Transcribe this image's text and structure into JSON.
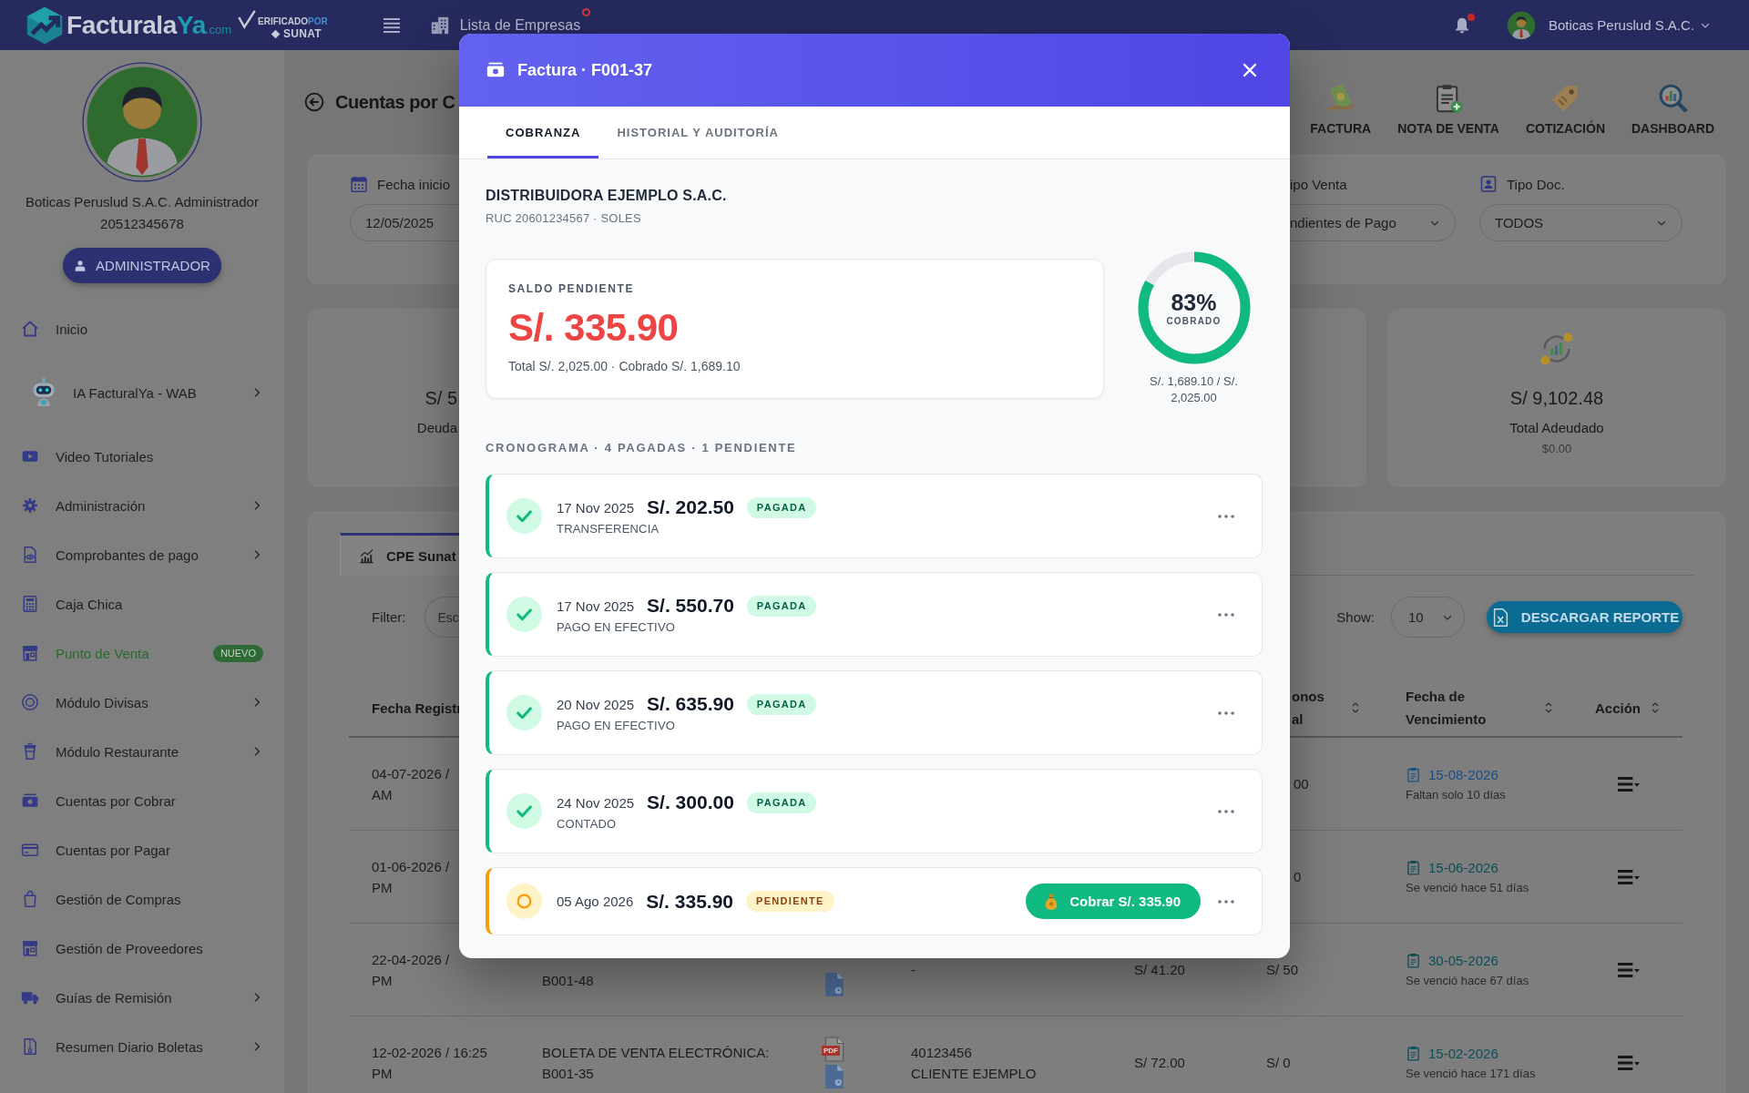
{
  "top_bar": {
    "brand": {
      "name": "Facturala",
      "accent": "Ya",
      "suffix": ".com"
    },
    "verified_badge": {
      "text": "ERIFICADO",
      "suffix": "POR",
      "authority": "SUNAT"
    },
    "company_list": {
      "label": "Lista de Empresas",
      "indicator": true
    },
    "notifications": {
      "unread": true
    },
    "account": "Boticas Peruslud S.A.C."
  },
  "sidebar": {
    "profile": {
      "name": "Boticas Peruslud S.A.C. Administrador",
      "ruc": "20512345678",
      "role": "ADMINISTRADOR"
    },
    "items": [
      {
        "kind": "link",
        "label": "Inicio",
        "expandable": false,
        "highlighted": false
      },
      {
        "kind": "assistant",
        "label": "IA FacturalYa - WAB",
        "expandable": true,
        "highlighted": false
      },
      {
        "kind": "link",
        "label": "Video Tutoriales",
        "expandable": false,
        "highlighted": false
      },
      {
        "kind": "link",
        "label": "Administración",
        "expandable": true,
        "highlighted": false
      },
      {
        "kind": "link",
        "label": "Comprobantes de pago",
        "expandable": true,
        "highlighted": false
      },
      {
        "kind": "link",
        "label": "Caja Chica",
        "expandable": false,
        "highlighted": false
      },
      {
        "kind": "link",
        "label": "Punto de Venta",
        "expandable": false,
        "highlighted": true,
        "badge": "NUEVO"
      },
      {
        "kind": "link",
        "label": "Módulo Divisas",
        "expandable": true,
        "highlighted": false
      },
      {
        "kind": "link",
        "label": "Módulo Restaurante",
        "expandable": true,
        "highlighted": false
      },
      {
        "kind": "link",
        "label": "Cuentas por Cobrar",
        "expandable": false,
        "highlighted": false
      },
      {
        "kind": "link",
        "label": "Cuentas por Pagar",
        "expandable": false,
        "highlighted": false
      },
      {
        "kind": "link",
        "label": "Gestión de Compras",
        "expandable": false,
        "highlighted": false
      },
      {
        "kind": "link",
        "label": "Gestión de Proveedores",
        "expandable": false,
        "highlighted": false
      },
      {
        "kind": "link",
        "label": "Guías de Remisión",
        "expandable": true,
        "highlighted": false
      },
      {
        "kind": "link",
        "label": "Resumen Diario Boletas",
        "expandable": true,
        "highlighted": false
      }
    ]
  },
  "page": {
    "title": "Cuentas por C",
    "quick_actions": [
      {
        "label": "FACTURA"
      },
      {
        "label": "NOTA DE VENTA"
      },
      {
        "label": "COTIZACIÓN"
      },
      {
        "label": "DASHBOARD"
      }
    ]
  },
  "filters": {
    "start_date": {
      "label": "Fecha inicio",
      "value": "12/05/2025"
    },
    "sale_type": {
      "label": "ipo Venta",
      "value": "ndientes de Pago"
    },
    "doc_type": {
      "label": "Tipo Doc.",
      "value": "TODOS"
    }
  },
  "summary_cards": {
    "debt": {
      "amount": "S/ 5",
      "label": "Deuda"
    },
    "total_owed": {
      "amount": "S/ 9,102.48",
      "label": "Total Adeudado",
      "sub": "$0.00"
    }
  },
  "table_panel": {
    "tabs": [
      {
        "label": "CPE Sunat",
        "selected": true
      }
    ],
    "filter": {
      "label": "Filter:",
      "placeholder": "Esc"
    },
    "page_size": {
      "label": "Show:",
      "value": "10"
    },
    "download_button": "DESCARGAR REPORTE",
    "columns": [
      {
        "lines": [
          "Fecha Registr"
        ]
      },
      {
        "lines": [
          "onos",
          "al"
        ],
        "sortable": true
      },
      {
        "lines": [
          "Fecha de",
          "Vencimiento"
        ],
        "sortable": true
      },
      {
        "lines": [
          "Acción"
        ],
        "sortable": true
      }
    ],
    "rows": [
      {
        "registered": [
          "04-07-2026 /",
          "AM"
        ],
        "paid": "00",
        "due": {
          "date": "15-08-2026",
          "note": "Faltan solo 10 días",
          "overdue": false
        }
      },
      {
        "registered": [
          "01-06-2026 /",
          "PM"
        ],
        "paid": "0",
        "due": {
          "date": "15-06-2026",
          "note": "Se venció hace 51 días",
          "overdue": true
        }
      },
      {
        "registered": [
          "22-04-2026 /",
          "PM"
        ],
        "document": {
          "number": "B001-48"
        },
        "client": [
          "-"
        ],
        "total": "S/ 41.20",
        "paid": "S/ 50",
        "due": {
          "date": "30-05-2026",
          "note": "Se venció hace 67 días",
          "overdue": true
        }
      },
      {
        "registered": [
          "12-02-2026 / 16:25",
          "PM"
        ],
        "document": {
          "type_label": "BOLETA DE VENTA ELECTRÓNICA:",
          "number": "B001-35",
          "file_label": "PDF"
        },
        "client": [
          "40123456",
          "CLIENTE EJEMPLO"
        ],
        "total": "S/ 72.00",
        "paid": "S/ 0",
        "due": {
          "date": "15-02-2026",
          "note": "Se venció hace 171 días",
          "overdue": true
        }
      }
    ]
  },
  "modal": {
    "title": "Factura · F001-37",
    "tabs": [
      {
        "label": "COBRANZA",
        "selected": true
      },
      {
        "label": "HISTORIAL Y AUDITORÍA",
        "selected": false
      }
    ],
    "customer": {
      "name": "DISTRIBUIDORA EJEMPLO S.A.C.",
      "details": "RUC 20601234567 · SOLES"
    },
    "balance": {
      "label": "SALDO PENDIENTE",
      "amount": "S/. 335.90",
      "summary": "Total S/. 2,025.00 · Cobrado S/. 1,689.10"
    },
    "progress": {
      "level": 0.83,
      "percent": "83%",
      "caption": "COBRADO",
      "detail": "S/. 1,689.10 / S/. 2,025.00"
    },
    "schedule": {
      "heading": "CRONOGRAMA · 4 PAGADAS · 1 PENDIENTE",
      "installments": [
        {
          "kind": "paid",
          "date": "17 Nov 2025",
          "amount": "S/. 202.50",
          "badge": "PAGADA",
          "method": "TRANSFERENCIA"
        },
        {
          "kind": "paid",
          "date": "17 Nov 2025",
          "amount": "S/. 550.70",
          "badge": "PAGADA",
          "method": "PAGO EN EFECTIVO"
        },
        {
          "kind": "paid",
          "date": "20 Nov 2025",
          "amount": "S/. 635.90",
          "badge": "PAGADA",
          "method": "PAGO EN EFECTIVO"
        },
        {
          "kind": "paid",
          "date": "24 Nov 2025",
          "amount": "S/. 300.00",
          "badge": "PAGADA",
          "method": "CONTADO"
        },
        {
          "kind": "pending",
          "date": "05 Ago 2026",
          "amount": "S/. 335.90",
          "badge": "PENDIENTE",
          "action": "Cobrar S/. 335.90"
        }
      ]
    }
  }
}
